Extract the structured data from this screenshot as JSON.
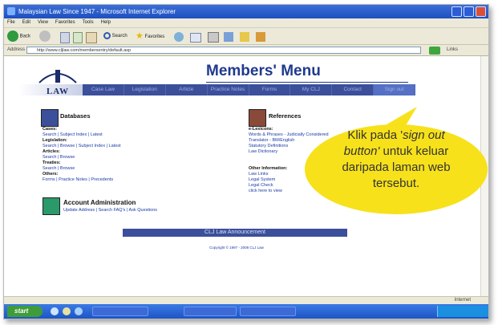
{
  "window": {
    "title": "Malaysian Law Since 1947 - Microsoft Internet Explorer"
  },
  "menu": [
    "File",
    "Edit",
    "View",
    "Favorites",
    "Tools",
    "Help"
  ],
  "toolbar": {
    "back": "Back",
    "search": "Search",
    "favorites": "Favorites"
  },
  "address": {
    "label": "Address",
    "url": "http://www.cljlaw.com/membersentry/default.asp",
    "go": "Go",
    "links": "Links"
  },
  "page": {
    "logo_text": "LAW",
    "title": "Members' Menu",
    "nav": [
      "Case Law",
      "Legislation",
      "Article",
      "Practice Notes",
      "Forms",
      "My CLJ",
      "Contact",
      "Sign out"
    ],
    "databases": {
      "title": "Databases",
      "rows": [
        {
          "head": "Cases:",
          "links": "Search | Subject Index | Latest"
        },
        {
          "head": "Legislation:",
          "links": "Search | Browse | Subject Index | Latest"
        },
        {
          "head": "Articles:",
          "links": "Search | Browse"
        },
        {
          "head": "Treaties:",
          "links": "Search | Browse"
        },
        {
          "head": "Others:",
          "links": "Forms | Practice Notes | Precedents"
        }
      ]
    },
    "references": {
      "title": "References",
      "lexicon_head": "e-Lexicons:",
      "lexicon_links": [
        "Words & Phrases - Judicially Considered",
        "Translator - BM/English",
        "Statutory Definitions",
        "Law Dictionary"
      ],
      "other_head": "Other Information:",
      "other_links": [
        "Law Links",
        "Legal System",
        "Legal Check",
        "click here to view"
      ]
    },
    "account": {
      "title": "Account Administration",
      "links": "Update Address | Search FAQ's | Ask Questions"
    },
    "announcement": "CLJ Law Announcement",
    "footer_copyright": "Copyright © 1997 - 2008 CLJ Law"
  },
  "status": {
    "zone": "Internet"
  },
  "taskbar": {
    "start": "start"
  },
  "callout": {
    "line1_pre": "Klik pada '",
    "line1_em": "sign out",
    "line2_em": "button'",
    "line2_post": " untuk keluar",
    "line3": "daripada laman web",
    "line4": "tersebut.",
    "color": "#f7e11a"
  }
}
